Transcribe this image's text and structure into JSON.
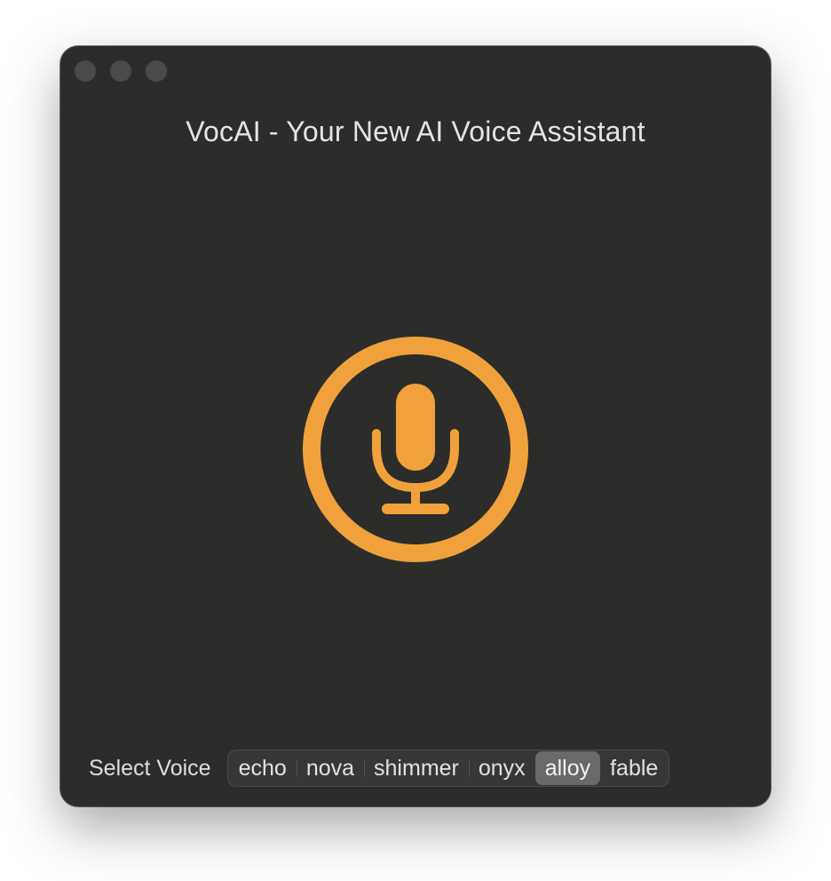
{
  "window": {
    "title": "VocAI - Your New AI Voice Assistant",
    "traffic_lights": [
      "close",
      "minimize",
      "zoom"
    ]
  },
  "mic_button": {
    "icon": "microphone-icon",
    "accent_color": "#f0a13b"
  },
  "voice_selector": {
    "label": "Select Voice",
    "options": [
      "echo",
      "nova",
      "shimmer",
      "onyx",
      "alloy",
      "fable"
    ],
    "selected": "alloy"
  }
}
